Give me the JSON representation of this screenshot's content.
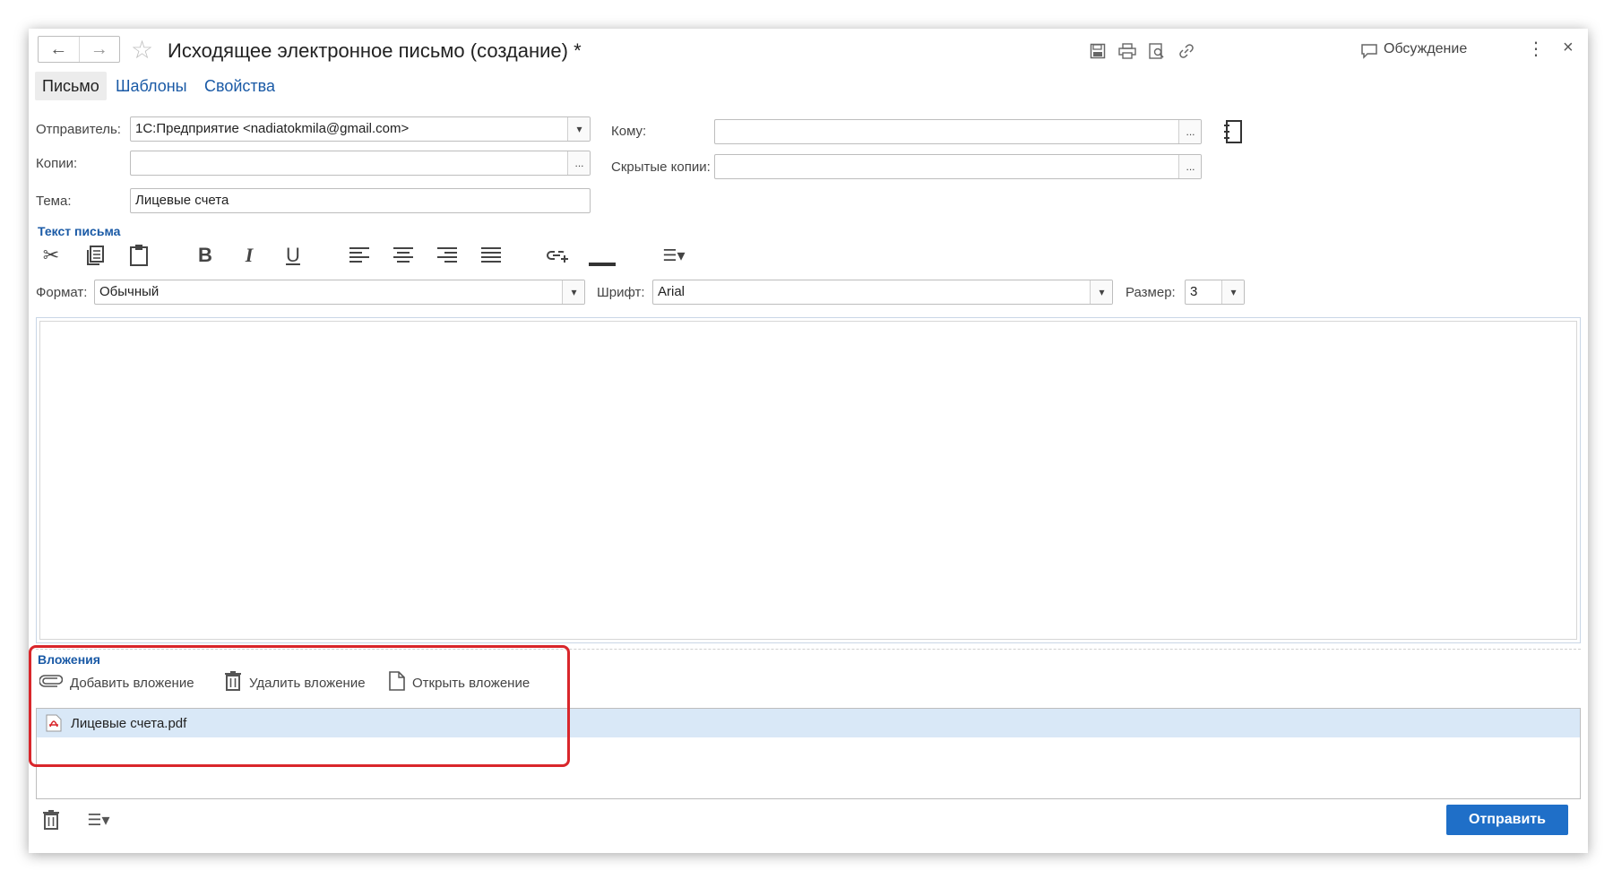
{
  "window": {
    "title": "Исходящее электронное письмо (создание) *",
    "nav": {
      "back": "←",
      "forward": "→"
    },
    "discussion_label": "Обсуждение"
  },
  "tabs": [
    {
      "label": "Письмо",
      "active": true
    },
    {
      "label": "Шаблоны",
      "active": false
    },
    {
      "label": "Свойства",
      "active": false
    }
  ],
  "form": {
    "sender_label": "Отправитель:",
    "sender_value": "1С:Предприятие <nadiatokmila@gmail.com>",
    "to_label": "Кому:",
    "to_value": "",
    "cc_label": "Копии:",
    "cc_value": "",
    "bcc_label": "Скрытые копии:",
    "bcc_value": "",
    "subject_label": "Тема:",
    "subject_value": "Лицевые счета",
    "picker_label": "..."
  },
  "editor": {
    "section_title": "Текст письма",
    "format_label": "Формат:",
    "format_value": "Обычный",
    "font_label": "Шрифт:",
    "font_value": "Arial",
    "size_label": "Размер:",
    "size_value": "3",
    "body": ""
  },
  "attachments": {
    "section_title": "Вложения",
    "add_label": "Добавить вложение",
    "delete_label": "Удалить вложение",
    "open_label": "Открыть вложение",
    "items": [
      {
        "name": "Лицевые счета.pdf",
        "selected": true
      }
    ]
  },
  "footer": {
    "send_label": "Отправить"
  },
  "colors": {
    "accent": "#1f6fc8",
    "link": "#1a5aa6",
    "highlight": "#d9262b",
    "selection": "#d9e8f7"
  }
}
